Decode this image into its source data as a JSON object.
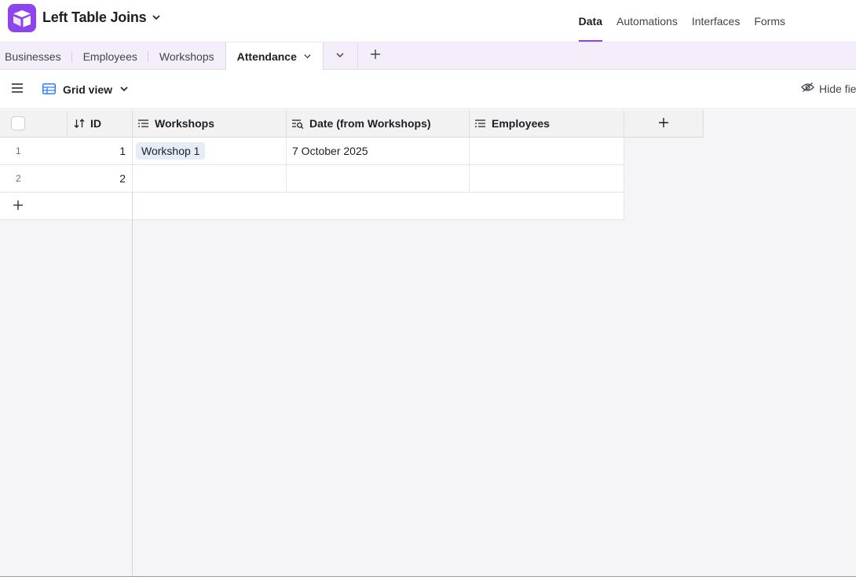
{
  "app": {
    "base_title": "Left Table Joins",
    "brand_color": "#8e44ec",
    "logo_icon": "airtable-logo-icon"
  },
  "top_nav": {
    "items": [
      {
        "label": "Data",
        "active": true
      },
      {
        "label": "Automations",
        "active": false
      },
      {
        "label": "Interfaces",
        "active": false
      },
      {
        "label": "Forms",
        "active": false
      }
    ]
  },
  "tables": {
    "tabs": [
      {
        "label": "Businesses",
        "active": false
      },
      {
        "label": "Employees",
        "active": false
      },
      {
        "label": "Workshops",
        "active": false
      },
      {
        "label": "Attendance",
        "active": true
      }
    ]
  },
  "viewbar": {
    "view_name": "Grid view",
    "view_icon": "grid-icon",
    "hide_fields_label": "Hide fie"
  },
  "grid": {
    "columns": [
      {
        "label": "ID",
        "icon": "sort-icon"
      },
      {
        "label": "Workshops",
        "icon": "linked-record-icon"
      },
      {
        "label": "Date (from Workshops)",
        "icon": "lookup-icon"
      },
      {
        "label": "Employees",
        "icon": "linked-record-icon"
      }
    ],
    "rows": [
      {
        "row_number": "1",
        "id": "1",
        "workshops": "Workshop 1",
        "date": "7 October 2025",
        "employees": ""
      },
      {
        "row_number": "2",
        "id": "2",
        "workshops": "",
        "date": "",
        "employees": ""
      }
    ]
  }
}
